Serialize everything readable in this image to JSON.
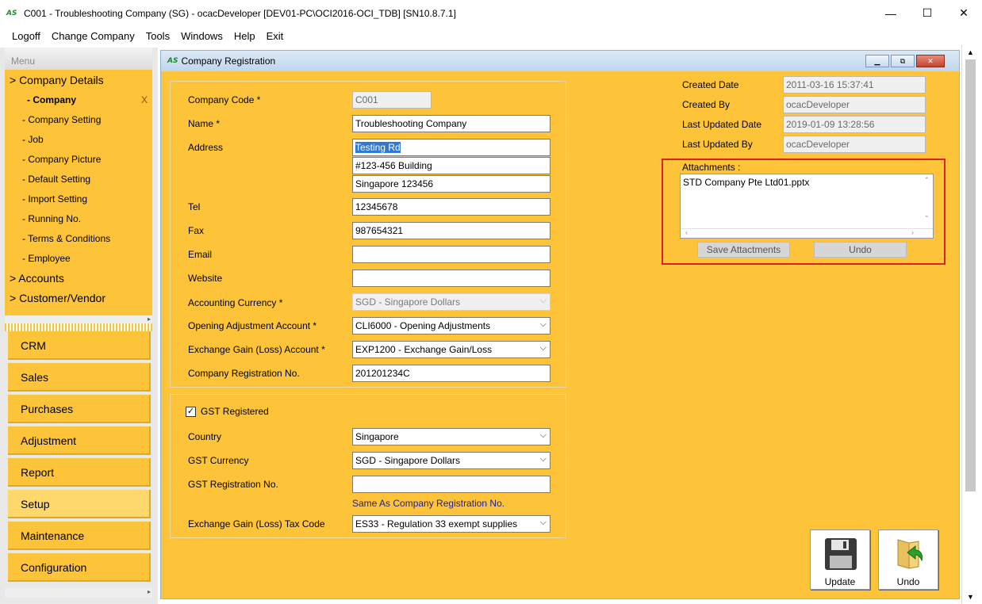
{
  "window": {
    "logo": "AS",
    "title": "C001 - Troubleshooting Company (SG) - ocacDeveloper [DEV01-PC\\OCI2016-OCI_TDB] [SN10.8.7.1]",
    "minimize": "—",
    "maximize": "☐",
    "close": "✕"
  },
  "menubar": [
    "Logoff",
    "Change Company",
    "Tools",
    "Windows",
    "Help",
    "Exit"
  ],
  "sidebar": {
    "header": "Menu",
    "tree": [
      {
        "label": "> Company Details"
      },
      {
        "label": "- Company"
      },
      {
        "label": "- Company Setting"
      },
      {
        "label": "- Job"
      },
      {
        "label": "- Company Picture"
      },
      {
        "label": "- Default Setting"
      },
      {
        "label": "- Import Setting"
      },
      {
        "label": "- Running No."
      },
      {
        "label": "- Terms & Conditions"
      },
      {
        "label": "- Employee"
      },
      {
        "label": "> Accounts"
      },
      {
        "label": "> Customer/Vendor"
      }
    ],
    "close_mark": "X",
    "modules": [
      "CRM",
      "Sales",
      "Purchases",
      "Adjustment",
      "Report",
      "Setup",
      "Maintenance",
      "Configuration"
    ],
    "active_module": "Setup"
  },
  "form": {
    "title": "Company Registration",
    "logo": "AS",
    "company_code": {
      "label": "Company Code *",
      "value": "C001"
    },
    "name": {
      "label": "Name *",
      "value": "Troubleshooting Company"
    },
    "address": {
      "label": "Address",
      "line1": "Testing Rd",
      "line2": "#123-456 Building",
      "line3": "Singapore 123456"
    },
    "tel": {
      "label": "Tel",
      "value": "12345678"
    },
    "fax": {
      "label": "Fax",
      "value": "987654321"
    },
    "email": {
      "label": "Email",
      "value": ""
    },
    "website": {
      "label": "Website",
      "value": ""
    },
    "accounting_currency": {
      "label": "Accounting Currency *",
      "value": "SGD - Singapore Dollars"
    },
    "opening_adjustment": {
      "label": "Opening Adjustment Account *",
      "value": "CLI6000 - Opening Adjustments"
    },
    "exchange_gain": {
      "label": "Exchange Gain (Loss) Account *",
      "value": "EXP1200 - Exchange Gain/Loss"
    },
    "company_reg_no": {
      "label": "Company Registration No.",
      "value": "201201234C"
    },
    "gst": {
      "registered_label": "GST Registered",
      "registered": true,
      "country": {
        "label": "Country",
        "value": "Singapore"
      },
      "currency": {
        "label": "GST Currency",
        "value": "SGD - Singapore Dollars"
      },
      "reg_no": {
        "label": "GST Registration No.",
        "value": ""
      },
      "same_as_link": "Same As Company Registration No.",
      "tax_code": {
        "label": "Exchange Gain (Loss) Tax Code",
        "value": "ES33 - Regulation 33 exempt supplies"
      }
    },
    "audit": {
      "created_date": {
        "label": "Created Date",
        "value": "2011-03-16 15:37:41"
      },
      "created_by": {
        "label": "Created By",
        "value": "ocacDeveloper"
      },
      "updated_date": {
        "label": "Last Updated Date",
        "value": "2019-01-09 13:28:56"
      },
      "updated_by": {
        "label": "Last Updated By",
        "value": "ocacDeveloper"
      }
    },
    "attachments": {
      "label": "Attachments :",
      "files": [
        "STD Company Pte Ltd01.pptx"
      ],
      "save_button": "Save Attactments",
      "undo_button": "Undo"
    },
    "update_button": "Update",
    "undo_button": "Undo"
  },
  "colors": {
    "panel": "#fdc43a",
    "highlight_border": "#e02020",
    "link": "#1a1aa0"
  }
}
